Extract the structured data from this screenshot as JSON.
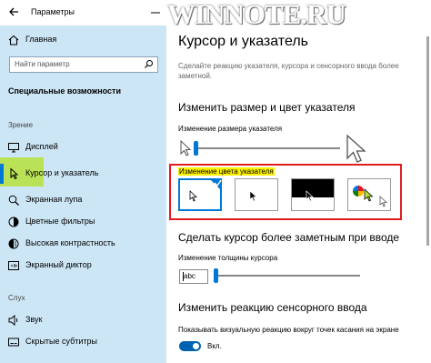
{
  "watermark": "WINNOTE.RU",
  "window": {
    "title": "Параметры"
  },
  "sidebar": {
    "home": "Главная",
    "search_placeholder": "Найти параметр",
    "section_title": "Специальные возможности",
    "group_vision": "Зрение",
    "group_hearing": "Слух",
    "items": [
      {
        "label": "Дисплей",
        "icon": "display-icon"
      },
      {
        "label": "Курсор и указатель",
        "icon": "pointer-icon",
        "active": true
      },
      {
        "label": "Экранная лупа",
        "icon": "magnifier-icon"
      },
      {
        "label": "Цветные фильтры",
        "icon": "color-filters-icon"
      },
      {
        "label": "Высокая контрастность",
        "icon": "contrast-icon"
      },
      {
        "label": "Экранный диктор",
        "icon": "narrator-icon"
      },
      {
        "label": "Звук",
        "icon": "speaker-icon"
      },
      {
        "label": "Скрытые субтитры",
        "icon": "captions-icon"
      }
    ]
  },
  "main": {
    "title": "Курсор и указатель",
    "description": "Сделайте реакцию указателя, курсора и сенсорного ввода более заметной.",
    "size_color_heading": "Изменить размер и цвет указателя",
    "size_label": "Изменение размера указателя",
    "size_value_fraction": 0.02,
    "color_label": "Изменение цвета указателя",
    "color_schemes": [
      {
        "name": "white",
        "selected": true
      },
      {
        "name": "black",
        "selected": false
      },
      {
        "name": "inverted",
        "selected": false
      },
      {
        "name": "custom",
        "selected": false
      }
    ],
    "cursor_heading": "Сделать курсор более заметным при вводе",
    "thickness_label": "Изменение толщины курсора",
    "thickness_preview": "abc",
    "touch_heading": "Изменить реакцию сенсорного ввода",
    "touch_label": "Показывать визуальную реакцию вокруг точек касания на экране",
    "toggle_label": "Вкл.",
    "toggle_on": true
  },
  "colors": {
    "accent": "#0078d7",
    "sidebar_bg": "#cde6f6",
    "highlight_red": "#e21c1c",
    "highlight_yellow": "#fff200",
    "highlight_green": "#b6e13a"
  }
}
